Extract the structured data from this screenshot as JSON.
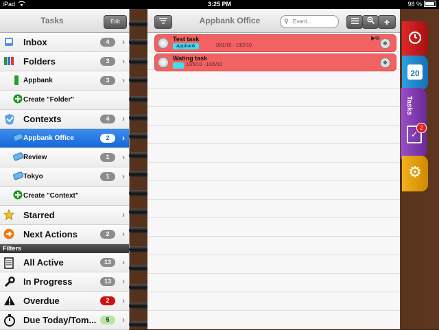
{
  "status_bar": {
    "device": "iPad",
    "time": "3:25 PM",
    "battery": "98 %"
  },
  "left_panel": {
    "title": "Tasks",
    "edit_label": "Edit",
    "items": [
      {
        "label": "Inbox",
        "badge": "4",
        "icon": "inbox-icon",
        "kind": "big"
      },
      {
        "label": "Folders",
        "badge": "3",
        "icon": "folders-icon",
        "kind": "big"
      },
      {
        "label": "Appbank",
        "badge": "3",
        "icon": "folder-green-icon",
        "kind": "small indent"
      },
      {
        "label": "Create \"Folder\"",
        "badge": "",
        "icon": "add-folder-icon",
        "kind": "small indent"
      },
      {
        "label": "Contexts",
        "badge": "4",
        "icon": "contexts-icon",
        "kind": "big"
      },
      {
        "label": "Appbank Office",
        "badge": "2",
        "icon": "context-tag-icon",
        "kind": "small indent selected"
      },
      {
        "label": "Review",
        "badge": "1",
        "icon": "context-tag-icon",
        "kind": "small indent"
      },
      {
        "label": "Tokyo",
        "badge": "1",
        "icon": "context-tag-icon",
        "kind": "small indent"
      },
      {
        "label": "Create \"Context\"",
        "badge": "",
        "icon": "add-context-icon",
        "kind": "small indent"
      },
      {
        "label": "Starred",
        "badge": "",
        "icon": "star-icon",
        "kind": "big"
      },
      {
        "label": "Next Actions",
        "badge": "2",
        "icon": "next-actions-icon",
        "kind": "big"
      }
    ],
    "filters_header": "Filters",
    "filters": [
      {
        "label": "All Active",
        "badge": "13",
        "icon": "clipboard-icon",
        "badge_color": ""
      },
      {
        "label": "In Progress",
        "badge": "13",
        "icon": "wrench-icon",
        "badge_color": ""
      },
      {
        "label": "Overdue",
        "badge": "2",
        "icon": "warning-icon",
        "badge_color": "red"
      },
      {
        "label": "Due Today/Tom...",
        "badge": "5",
        "icon": "stopwatch-icon",
        "badge_color": "green"
      }
    ]
  },
  "right_panel": {
    "title": "Appbank Office",
    "search_placeholder": "Event...",
    "tasks": [
      {
        "name": "Test task",
        "tag": "Appbank",
        "dates": "10/1/10 - 10/2/10",
        "color": "#f26262"
      },
      {
        "name": "Wating task",
        "tag": "",
        "dates": "10/5/10 - 10/5/10",
        "color": "#f26262"
      }
    ]
  },
  "side_tabs": {
    "tasks_label": "Tasks",
    "calendar_day": "20",
    "tasks_badge": "2"
  },
  "colors": {
    "selection": "#1467d8",
    "task_bg": "#f26262",
    "tag": "#3fe0f0"
  }
}
